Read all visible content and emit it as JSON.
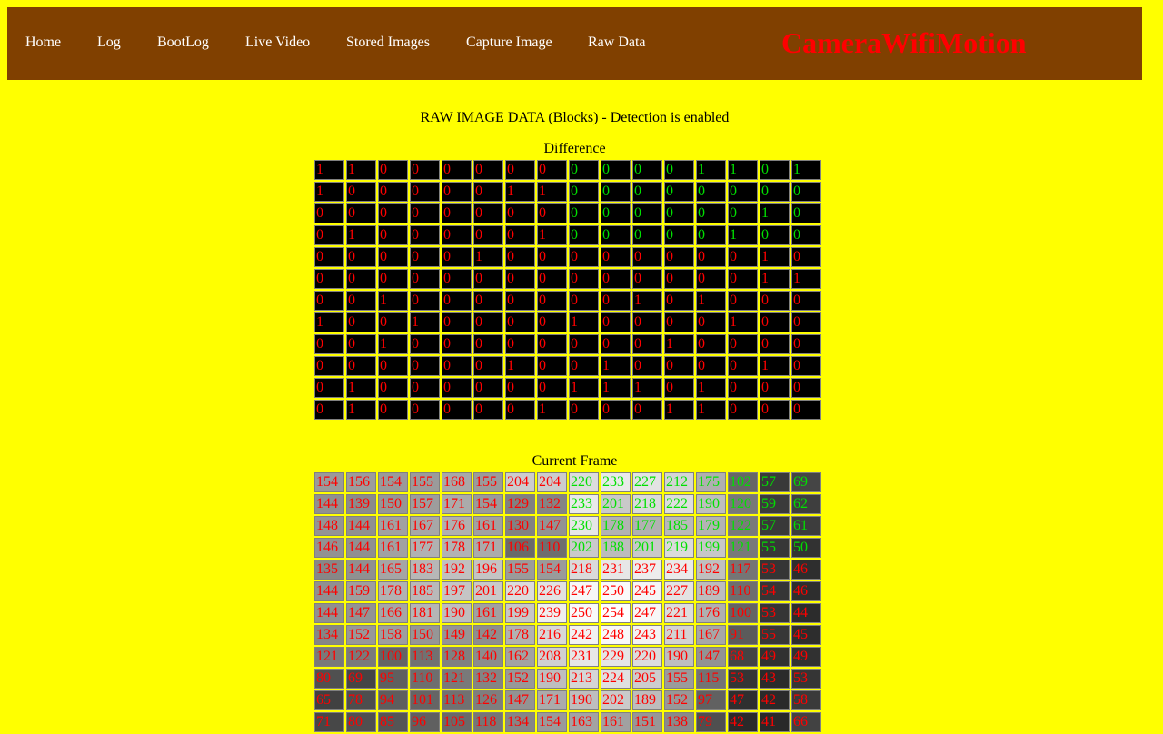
{
  "nav": {
    "items": [
      "Home",
      "Log",
      "BootLog",
      "Live Video",
      "Stored Images",
      "Capture Image",
      "Raw Data"
    ],
    "brand": "CameraWifiMotion"
  },
  "page_title": "RAW IMAGE DATA (Blocks) - Detection is enabled",
  "colors": {
    "page_background": "#ffff00",
    "navbar_background": "#804000",
    "nav_text": "#ffffff",
    "brand_text": "#ff0000",
    "changed_text": "#ff0000",
    "unchanged_text": "#00e000"
  },
  "difference": {
    "caption": "Difference",
    "rows": [
      [
        1,
        1,
        0,
        0,
        0,
        0,
        0,
        0,
        0,
        0,
        0,
        0,
        1,
        1,
        0,
        1
      ],
      [
        1,
        0,
        0,
        0,
        0,
        0,
        1,
        1,
        0,
        0,
        0,
        0,
        0,
        0,
        0,
        0
      ],
      [
        0,
        0,
        0,
        0,
        0,
        0,
        0,
        0,
        0,
        0,
        0,
        0,
        0,
        0,
        1,
        0
      ],
      [
        0,
        1,
        0,
        0,
        0,
        0,
        0,
        1,
        0,
        0,
        0,
        0,
        0,
        1,
        0,
        0
      ],
      [
        0,
        0,
        0,
        0,
        0,
        1,
        0,
        0,
        0,
        0,
        0,
        0,
        0,
        0,
        1,
        0
      ],
      [
        0,
        0,
        0,
        0,
        0,
        0,
        0,
        0,
        0,
        0,
        0,
        0,
        0,
        0,
        1,
        1
      ],
      [
        0,
        0,
        1,
        0,
        0,
        0,
        0,
        0,
        0,
        0,
        1,
        0,
        1,
        0,
        0,
        0
      ],
      [
        1,
        0,
        0,
        1,
        0,
        0,
        0,
        0,
        1,
        0,
        0,
        0,
        0,
        1,
        0,
        0
      ],
      [
        0,
        0,
        1,
        0,
        0,
        0,
        0,
        0,
        0,
        0,
        0,
        1,
        0,
        0,
        0,
        0
      ],
      [
        0,
        0,
        0,
        0,
        0,
        0,
        1,
        0,
        0,
        1,
        0,
        0,
        0,
        0,
        1,
        0
      ],
      [
        0,
        1,
        0,
        0,
        0,
        0,
        0,
        0,
        1,
        1,
        1,
        0,
        1,
        0,
        0,
        0
      ],
      [
        0,
        1,
        0,
        0,
        0,
        0,
        0,
        1,
        0,
        0,
        0,
        1,
        1,
        0,
        0,
        0
      ]
    ],
    "detection_mask": [
      [
        0,
        0,
        0,
        0,
        0,
        0,
        0,
        0,
        1,
        1,
        1,
        1,
        1,
        1,
        1,
        1
      ],
      [
        0,
        0,
        0,
        0,
        0,
        0,
        0,
        0,
        1,
        1,
        1,
        1,
        1,
        1,
        1,
        1
      ],
      [
        0,
        0,
        0,
        0,
        0,
        0,
        0,
        0,
        1,
        1,
        1,
        1,
        1,
        1,
        1,
        1
      ],
      [
        0,
        0,
        0,
        0,
        0,
        0,
        0,
        0,
        1,
        1,
        1,
        1,
        1,
        1,
        1,
        1
      ],
      [
        0,
        0,
        0,
        0,
        0,
        0,
        0,
        0,
        0,
        0,
        0,
        0,
        0,
        0,
        0,
        0
      ],
      [
        0,
        0,
        0,
        0,
        0,
        0,
        0,
        0,
        0,
        0,
        0,
        0,
        0,
        0,
        0,
        0
      ],
      [
        0,
        0,
        0,
        0,
        0,
        0,
        0,
        0,
        0,
        0,
        0,
        0,
        0,
        0,
        0,
        0
      ],
      [
        0,
        0,
        0,
        0,
        0,
        0,
        0,
        0,
        0,
        0,
        0,
        0,
        0,
        0,
        0,
        0
      ],
      [
        0,
        0,
        0,
        0,
        0,
        0,
        0,
        0,
        0,
        0,
        0,
        0,
        0,
        0,
        0,
        0
      ],
      [
        0,
        0,
        0,
        0,
        0,
        0,
        0,
        0,
        0,
        0,
        0,
        0,
        0,
        0,
        0,
        0
      ],
      [
        0,
        0,
        0,
        0,
        0,
        0,
        0,
        0,
        0,
        0,
        0,
        0,
        0,
        0,
        0,
        0
      ],
      [
        0,
        0,
        0,
        0,
        0,
        0,
        0,
        0,
        0,
        0,
        0,
        0,
        0,
        0,
        0,
        0
      ]
    ]
  },
  "current_frame": {
    "caption": "Current Frame",
    "rows": [
      [
        154,
        156,
        154,
        155,
        168,
        155,
        204,
        204,
        220,
        233,
        227,
        212,
        175,
        102,
        57,
        69
      ],
      [
        144,
        139,
        150,
        157,
        171,
        154,
        129,
        132,
        233,
        201,
        218,
        222,
        190,
        120,
        59,
        62
      ],
      [
        148,
        144,
        161,
        167,
        176,
        161,
        130,
        147,
        230,
        178,
        177,
        185,
        179,
        122,
        57,
        61
      ],
      [
        146,
        144,
        161,
        177,
        178,
        171,
        106,
        110,
        202,
        188,
        201,
        219,
        199,
        121,
        55,
        50
      ],
      [
        135,
        144,
        165,
        183,
        192,
        196,
        155,
        154,
        218,
        231,
        237,
        234,
        192,
        117,
        53,
        46
      ],
      [
        144,
        159,
        178,
        185,
        197,
        201,
        220,
        226,
        247,
        250,
        245,
        227,
        189,
        110,
        54,
        46
      ],
      [
        144,
        147,
        166,
        181,
        190,
        161,
        199,
        239,
        250,
        254,
        247,
        221,
        176,
        100,
        53,
        44
      ],
      [
        134,
        152,
        158,
        150,
        149,
        142,
        178,
        216,
        242,
        248,
        243,
        211,
        167,
        91,
        55,
        45
      ],
      [
        121,
        122,
        100,
        113,
        128,
        140,
        162,
        208,
        231,
        229,
        220,
        190,
        147,
        68,
        49,
        49
      ],
      [
        80,
        69,
        95,
        110,
        121,
        132,
        152,
        190,
        213,
        224,
        205,
        155,
        115,
        53,
        43,
        53
      ],
      [
        65,
        78,
        94,
        101,
        113,
        126,
        147,
        171,
        190,
        202,
        189,
        152,
        97,
        47,
        42,
        58
      ],
      [
        71,
        80,
        85,
        96,
        105,
        118,
        134,
        154,
        163,
        161,
        151,
        138,
        79,
        42,
        41,
        66
      ]
    ]
  }
}
